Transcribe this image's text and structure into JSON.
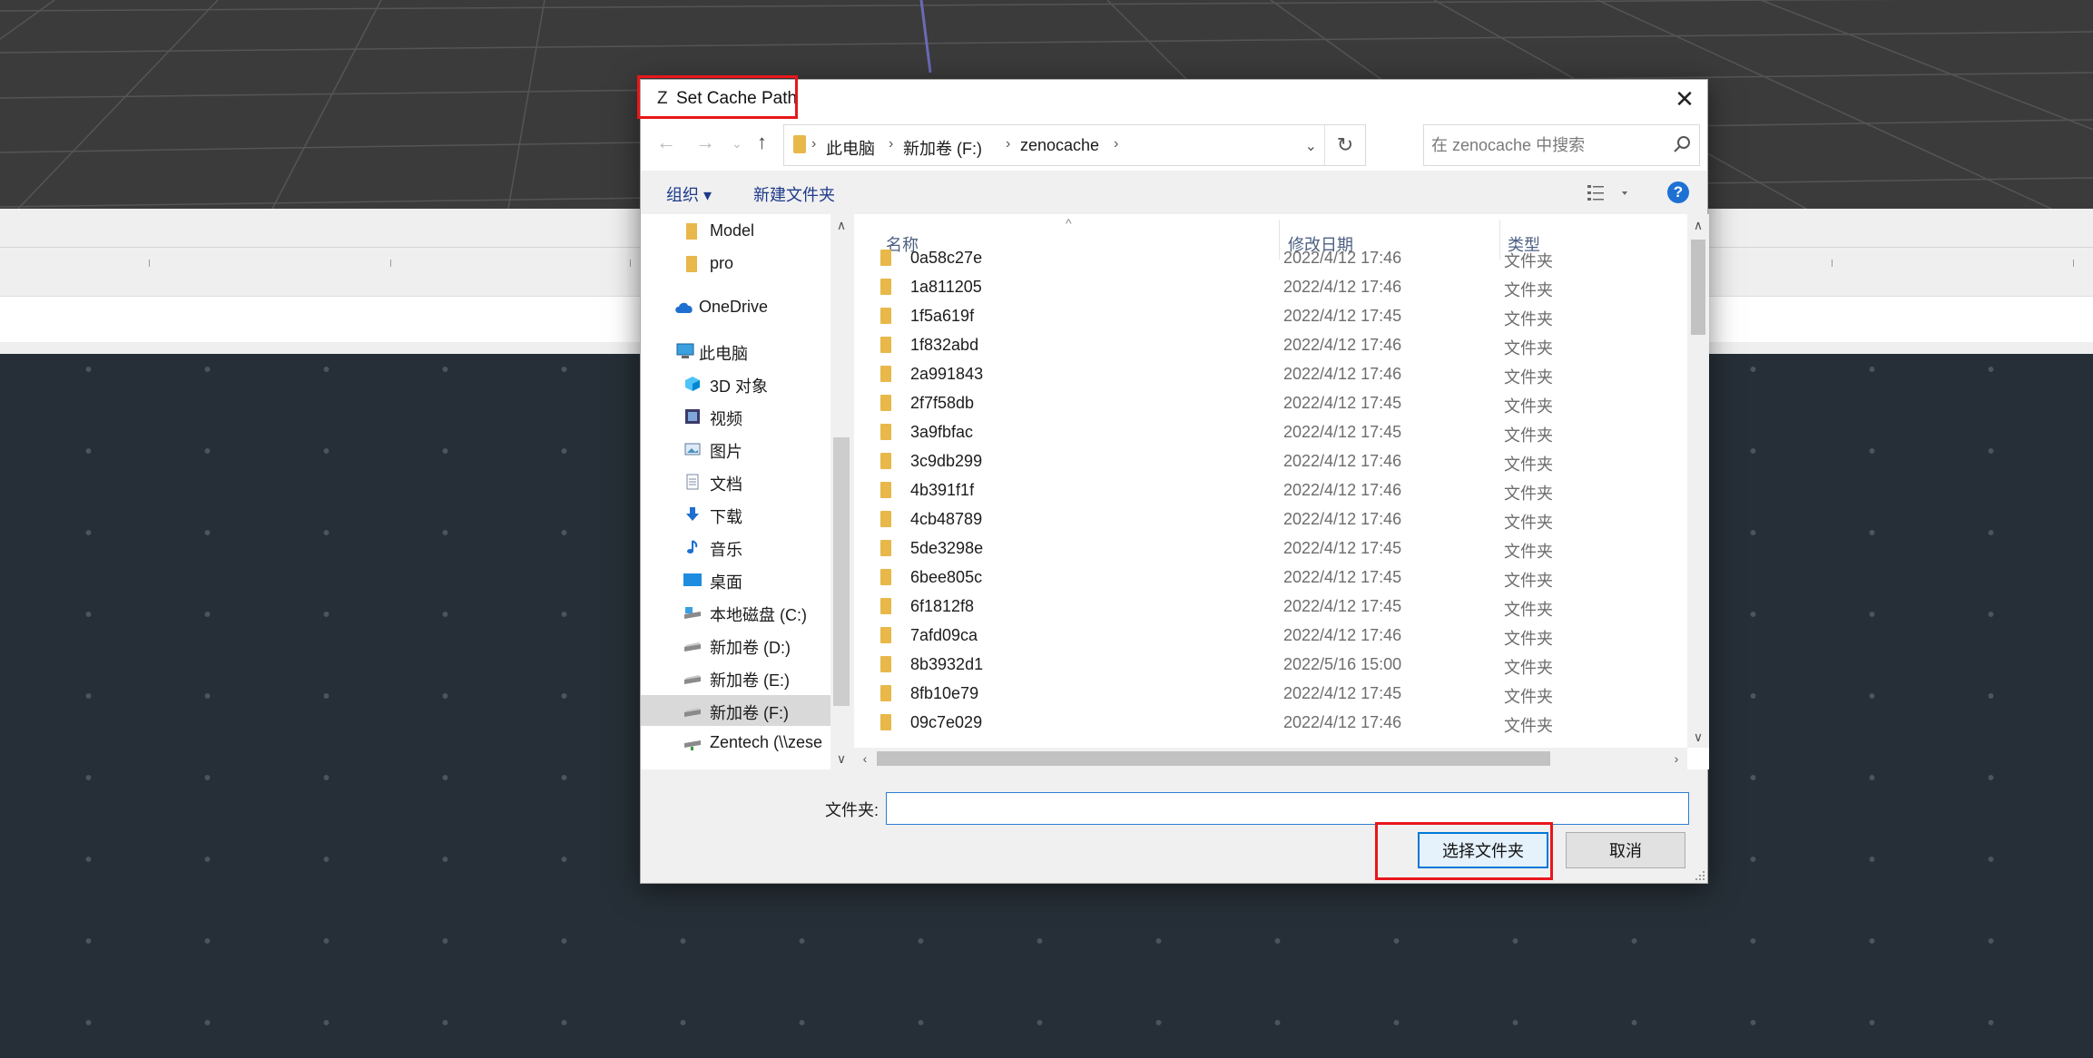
{
  "dialog": {
    "app_icon": "Z",
    "title": "Set Cache Path",
    "close": "✕"
  },
  "navbar": {
    "breadcrumbs": [
      "此电脑",
      "新加卷 (F:)",
      "zenocache"
    ],
    "search_placeholder": "在 zenocache 中搜索"
  },
  "toolbar": {
    "organize": "组织 ▾",
    "new_folder": "新建文件夹",
    "help": "?"
  },
  "nav_pane": {
    "items": [
      {
        "label": "Model",
        "icon": "folder-icon"
      },
      {
        "label": "pro",
        "icon": "folder-icon"
      },
      {
        "label": "OneDrive",
        "icon": "cloud-icon"
      },
      {
        "label": "此电脑",
        "icon": "computer-icon"
      },
      {
        "label": "3D 对象",
        "icon": "cube-icon"
      },
      {
        "label": "视频",
        "icon": "video-icon"
      },
      {
        "label": "图片",
        "icon": "picture-icon"
      },
      {
        "label": "文档",
        "icon": "document-icon"
      },
      {
        "label": "下载",
        "icon": "download-icon"
      },
      {
        "label": "音乐",
        "icon": "music-icon"
      },
      {
        "label": "桌面",
        "icon": "desktop-icon"
      },
      {
        "label": "本地磁盘 (C:)",
        "icon": "drive-icon"
      },
      {
        "label": "新加卷 (D:)",
        "icon": "drive-icon"
      },
      {
        "label": "新加卷 (E:)",
        "icon": "drive-icon"
      },
      {
        "label": "新加卷 (F:)",
        "icon": "drive-icon",
        "selected": true
      },
      {
        "label": "Zentech (\\\\zese",
        "icon": "network-drive-icon"
      }
    ]
  },
  "file_list": {
    "columns": [
      "名称",
      "修改日期",
      "类型"
    ],
    "rows": [
      {
        "name": "0a58c27e",
        "date": "2022/4/12 17:46",
        "type": "文件夹"
      },
      {
        "name": "1a811205",
        "date": "2022/4/12 17:46",
        "type": "文件夹"
      },
      {
        "name": "1f5a619f",
        "date": "2022/4/12 17:45",
        "type": "文件夹"
      },
      {
        "name": "1f832abd",
        "date": "2022/4/12 17:46",
        "type": "文件夹"
      },
      {
        "name": "2a991843",
        "date": "2022/4/12 17:46",
        "type": "文件夹"
      },
      {
        "name": "2f7f58db",
        "date": "2022/4/12 17:45",
        "type": "文件夹"
      },
      {
        "name": "3a9fbfac",
        "date": "2022/4/12 17:45",
        "type": "文件夹"
      },
      {
        "name": "3c9db299",
        "date": "2022/4/12 17:46",
        "type": "文件夹"
      },
      {
        "name": "4b391f1f",
        "date": "2022/4/12 17:46",
        "type": "文件夹"
      },
      {
        "name": "4cb48789",
        "date": "2022/4/12 17:46",
        "type": "文件夹"
      },
      {
        "name": "5de3298e",
        "date": "2022/4/12 17:45",
        "type": "文件夹"
      },
      {
        "name": "6bee805c",
        "date": "2022/4/12 17:45",
        "type": "文件夹"
      },
      {
        "name": "6f1812f8",
        "date": "2022/4/12 17:45",
        "type": "文件夹"
      },
      {
        "name": "7afd09ca",
        "date": "2022/4/12 17:46",
        "type": "文件夹"
      },
      {
        "name": "8b3932d1",
        "date": "2022/5/16 15:00",
        "type": "文件夹"
      },
      {
        "name": "8fb10e79",
        "date": "2022/4/12 17:45",
        "type": "文件夹"
      },
      {
        "name": "09c7e029",
        "date": "2022/4/12 17:46",
        "type": "文件夹"
      }
    ]
  },
  "footer": {
    "folder_label": "文件夹:",
    "folder_value": "",
    "select_button": "选择文件夹",
    "cancel_button": "取消"
  },
  "colors": {
    "highlight_box": "#e8161b",
    "accent": "#0078d7",
    "folder": "#e8b84a"
  }
}
